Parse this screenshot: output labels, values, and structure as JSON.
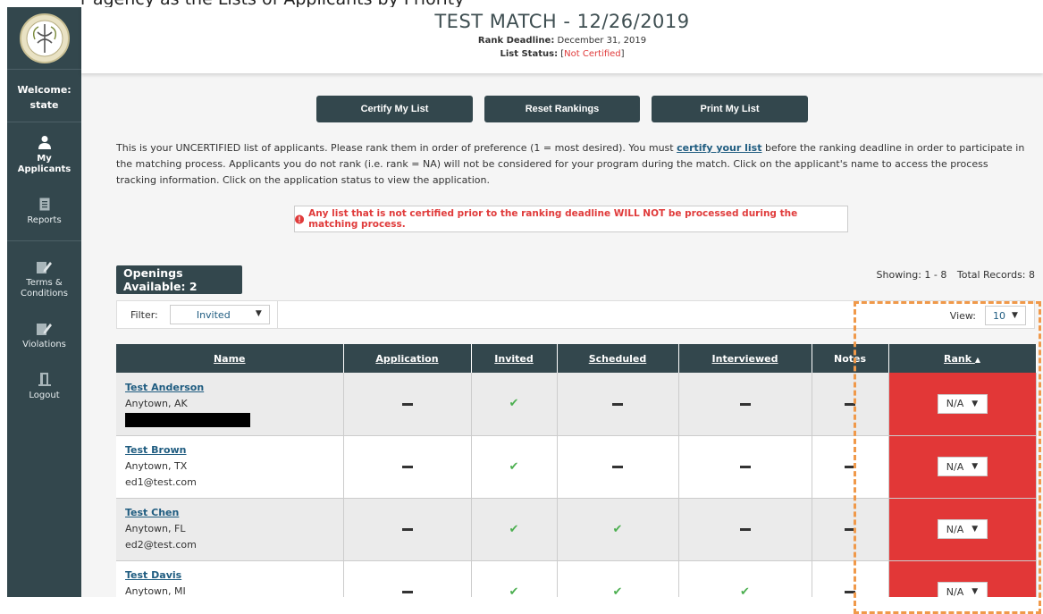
{
  "top_cut_text": "r agency as the Lists of Applicants by Priority",
  "app": {
    "title": "TEST MATCH - 12/26/2019",
    "rank_deadline_label": "Rank Deadline:",
    "rank_deadline_value": "December 31, 2019",
    "list_status_label": "List Status:",
    "list_status_open": "[",
    "list_status_value": "Not Certified",
    "list_status_close": "]"
  },
  "sidebar": {
    "welcome_label": "Welcome:",
    "welcome_user": "state",
    "items": [
      {
        "label": "My Applicants",
        "icon": "user-icon"
      },
      {
        "label": "Reports",
        "icon": "document-icon"
      },
      {
        "label": "Terms & Conditions",
        "icon": "edit-icon"
      },
      {
        "label": "Violations",
        "icon": "edit-icon"
      },
      {
        "label": "Logout",
        "icon": "door-icon"
      }
    ]
  },
  "toolbar": {
    "certify_label": "Certify My List",
    "reset_label": "Reset Rankings",
    "print_label": "Print My List"
  },
  "intro": {
    "part1": "This is your UNCERTIFIED list of applicants. Please rank them in order of preference (1 = most desired). You must ",
    "link": "certify your list",
    "part2": " before the ranking deadline in order to participate in the matching process. Applicants you do not rank (i.e. rank = NA) will not be considered for your program during the match. Click on the applicant's name to access the process tracking information. Click on the application status to view the application."
  },
  "alert": {
    "icon": "exclamation-circle-icon",
    "text": "Any list that is not certified prior to the ranking deadline WILL NOT be processed during the matching process."
  },
  "openings_label": "Openings Available: 2",
  "showing_text": "Showing: 1 - 8",
  "total_text": "Total Records: 8",
  "filter": {
    "label": "Filter:",
    "value": "Invited"
  },
  "view": {
    "label": "View:",
    "value": "10"
  },
  "table": {
    "columns": [
      "Name",
      "Application",
      "Invited",
      "Scheduled",
      "Interviewed",
      "Notes",
      "Rank"
    ],
    "rank_sort_icon": "▲",
    "rows": [
      {
        "name": "Test Anderson",
        "location": "Anytown, AK",
        "email": "",
        "invited": true,
        "scheduled": false,
        "interviewed": false,
        "rank": "N/A"
      },
      {
        "name": "Test Brown",
        "location": "Anytown, TX",
        "email": "ed1@test.com",
        "invited": true,
        "scheduled": false,
        "interviewed": false,
        "rank": "N/A"
      },
      {
        "name": "Test Chen",
        "location": "Anytown, FL",
        "email": "ed2@test.com",
        "invited": true,
        "scheduled": true,
        "interviewed": false,
        "rank": "N/A"
      },
      {
        "name": "Test Davis",
        "location": "Anytown, MI",
        "email": "",
        "invited": true,
        "scheduled": true,
        "interviewed": true,
        "rank": "N/A"
      }
    ]
  },
  "colors": {
    "sidebar": "#33474d",
    "rank_cell": "#e23737",
    "link": "#1f5c80",
    "alert": "#e03b3b",
    "check": "#4caf50",
    "highlight": "#f0994a"
  }
}
